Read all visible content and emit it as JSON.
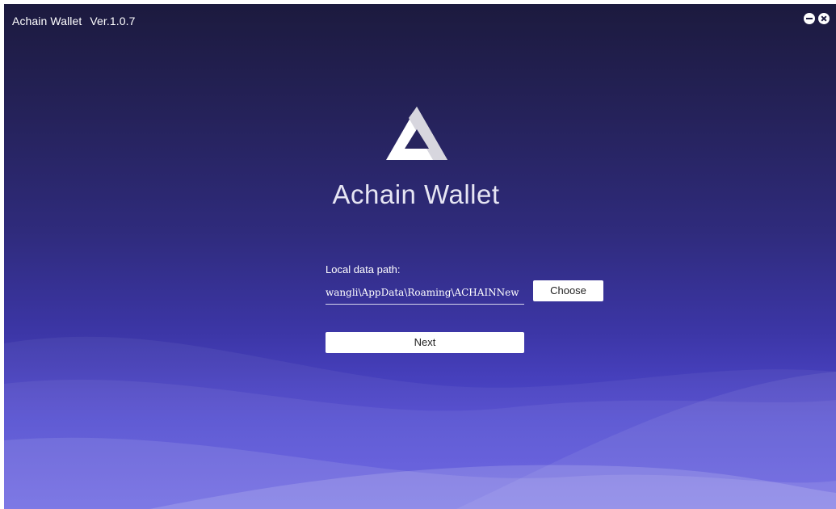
{
  "window": {
    "app_title": "Achain Wallet",
    "version": "Ver.1.0.7",
    "minimize_icon": "minimize-circle-icon",
    "close_icon": "close-circle-icon"
  },
  "brand": {
    "logo_icon": "achain-triangle-logo",
    "name": "Achain Wallet"
  },
  "form": {
    "path_label": "Local data path:",
    "path_value": "wangli\\AppData\\Roaming\\ACHAINNew",
    "choose_label": "Choose",
    "next_label": "Next"
  },
  "colors": {
    "background_top": "#1c1a3e",
    "background_bottom": "#5e59e0",
    "button_bg": "#ffffff"
  }
}
